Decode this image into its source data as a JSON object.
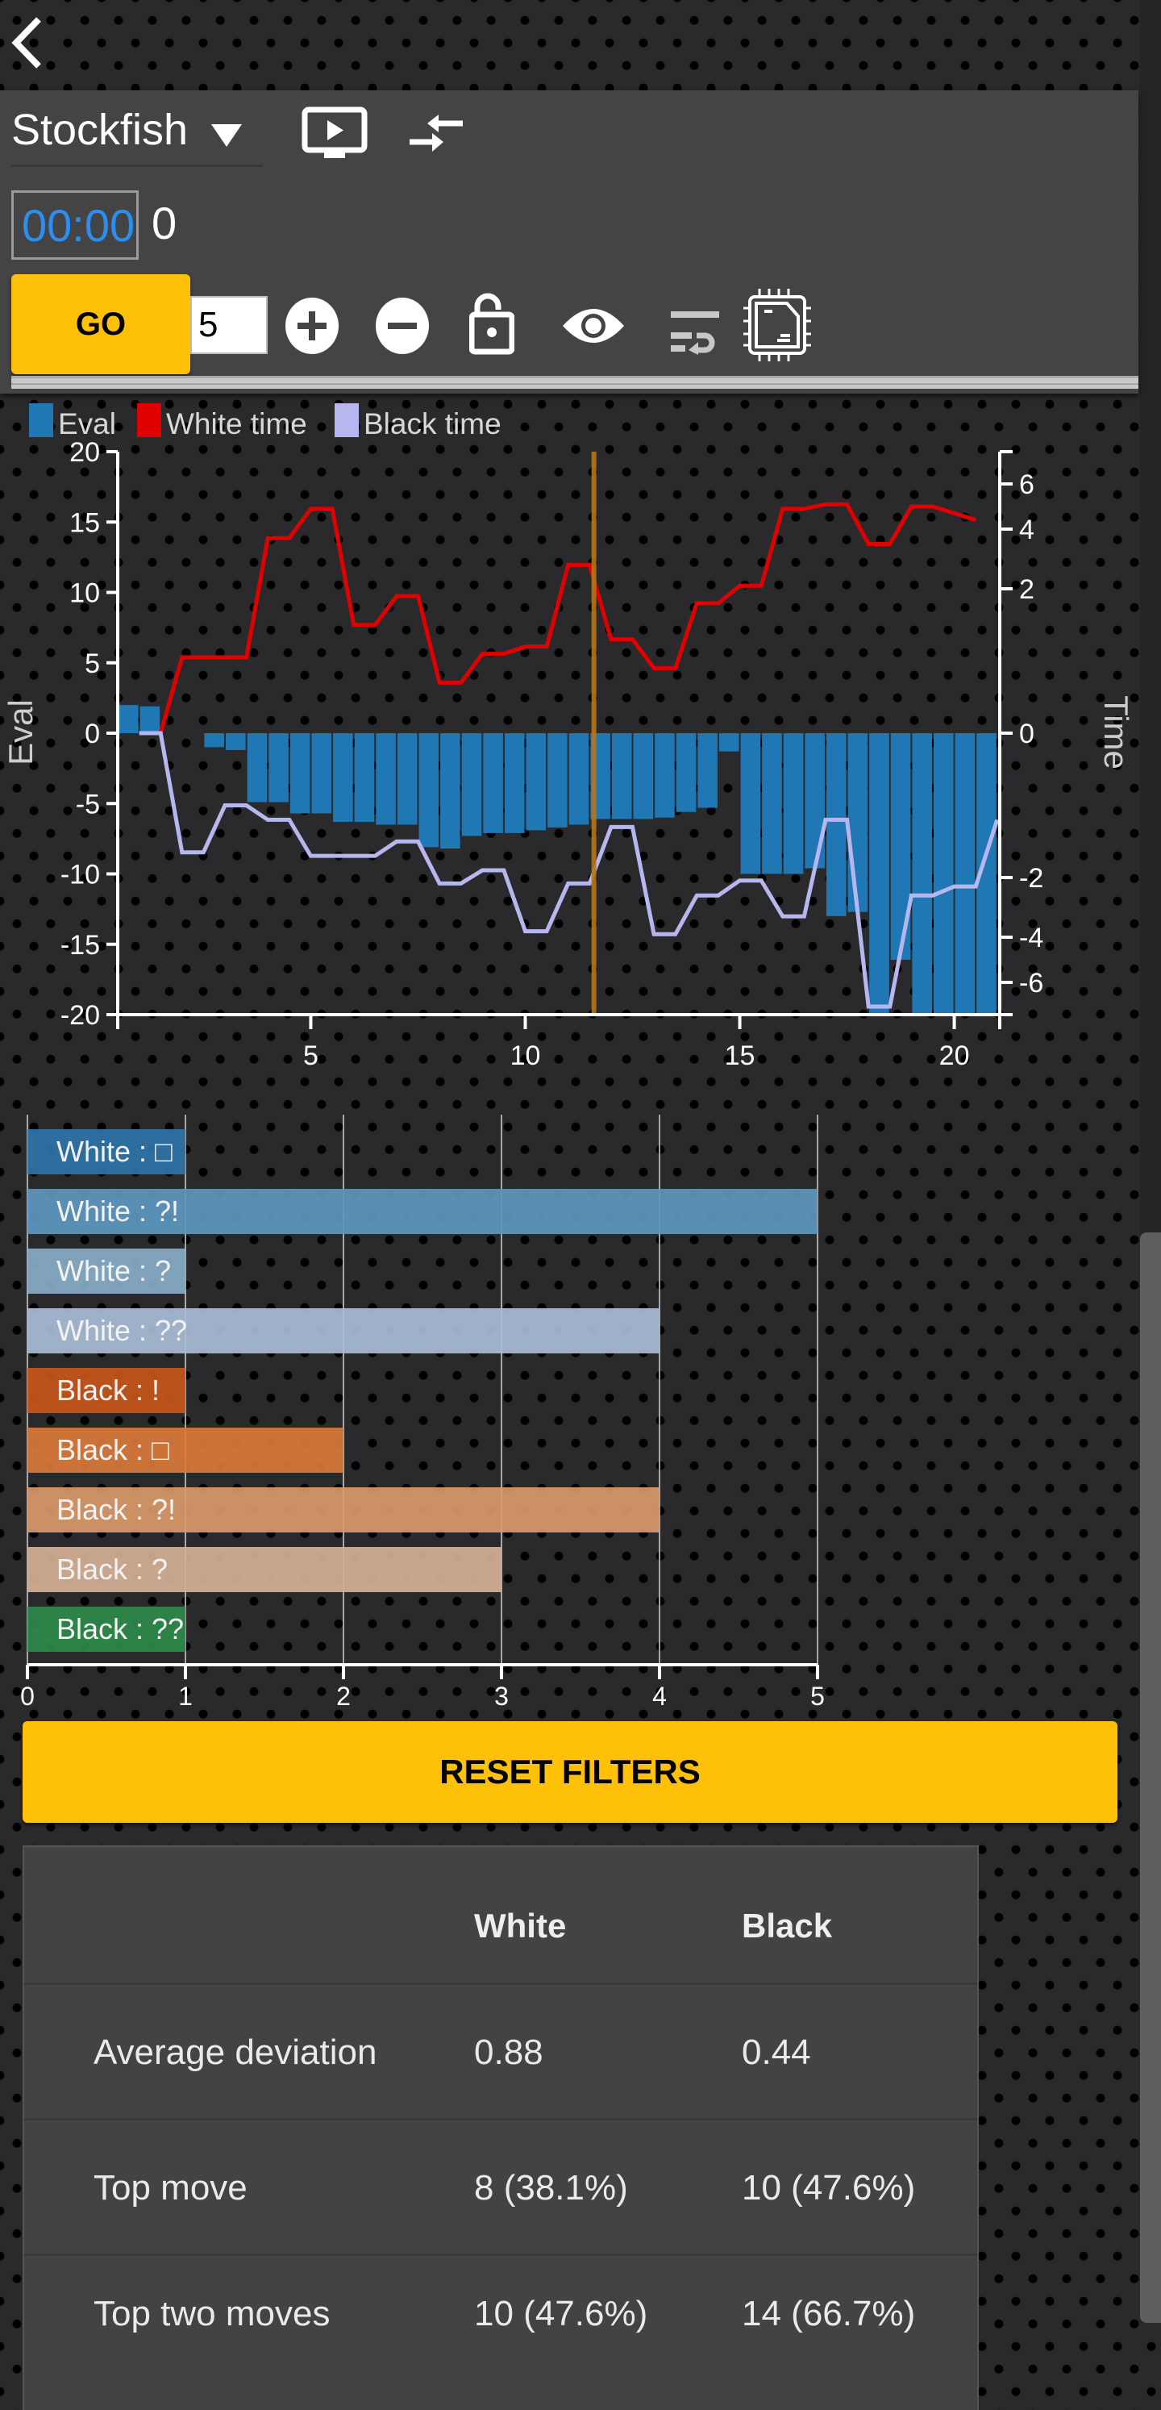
{
  "nav": {
    "back_icon": "chevron-left-icon"
  },
  "engine": {
    "name": "Stockfish",
    "timer": "00:00",
    "nodes": "0",
    "go_label": "GO",
    "depth_value": "5",
    "icons": [
      "monitor-play-icon",
      "collapse-arrows-icon",
      "plus-circle-icon",
      "minus-circle-icon",
      "unlock-icon",
      "eye-icon",
      "wrap-lines-icon",
      "cpu-chip-icon"
    ]
  },
  "chart_data": [
    {
      "type": "bar+line",
      "title": "",
      "legend": [
        {
          "name": "Eval",
          "color": "#1f77b4"
        },
        {
          "name": "White time",
          "color": "#e00000"
        },
        {
          "name": "Black time",
          "color": "#b7b7f0"
        }
      ],
      "legend_placement": "top-left",
      "xlabel": "",
      "ylabel": "Eval",
      "y2label": "Time",
      "x_ticks": [
        5,
        10,
        15,
        20
      ],
      "x_range": [
        0.5,
        21.06
      ],
      "ylim": [
        -20,
        20
      ],
      "y_ticks": [
        20,
        15,
        10,
        5,
        0,
        -5,
        -10,
        -15,
        -20
      ],
      "y2_ticks": [
        6,
        4,
        2,
        0,
        -2,
        -4,
        -6
      ],
      "current_move_marker": 11.6,
      "eval": {
        "x": [
          0.5,
          1,
          1.5,
          2,
          2.5,
          3,
          3.5,
          4,
          4.5,
          5,
          5.5,
          6,
          6.5,
          7,
          7.5,
          8,
          8.5,
          9,
          9.5,
          10,
          10.5,
          11,
          11.5,
          12,
          12.5,
          13,
          13.5,
          14,
          14.5,
          15,
          15.5,
          16,
          16.5,
          17,
          17.5,
          18,
          18.5,
          19,
          19.5,
          20,
          20.5
        ],
        "values": [
          2.0,
          1.9,
          0,
          0,
          -1.0,
          -1.2,
          -4.9,
          -4.9,
          -5.7,
          -5.7,
          -6.3,
          -6.3,
          -6.5,
          -6.5,
          -8.1,
          -8.2,
          -7.3,
          -7.1,
          -7.1,
          -6.9,
          -6.7,
          -6.5,
          -6.1,
          -6.1,
          -6.1,
          -6.0,
          -5.6,
          -5.3,
          -1.3,
          -10.0,
          -10.0,
          -10.0,
          -9.6,
          -13.0,
          -12.7,
          -20.0,
          -16.1,
          -20.0,
          -20.0,
          -20.0,
          -20.0
        ]
      },
      "white_time": {
        "x": [
          1,
          1.5,
          2,
          2.5,
          3,
          3.5,
          4,
          4.5,
          5,
          5.5,
          6,
          6.5,
          7,
          7.5,
          8,
          8.5,
          9,
          9.5,
          10,
          10.5,
          11,
          11.5,
          12,
          12.5,
          13,
          13.5,
          14,
          14.5,
          15,
          15.5,
          16,
          16.5,
          17,
          17.5,
          18,
          18.5,
          19,
          19.5,
          20,
          20.5
        ],
        "values": [
          0,
          0,
          1.05,
          1.05,
          1.05,
          1.05,
          3.7,
          3.7,
          4.9,
          4.9,
          1.5,
          1.5,
          1.9,
          1.9,
          0.7,
          0.7,
          1.1,
          1.1,
          1.2,
          1.2,
          2.8,
          2.8,
          1.3,
          1.3,
          0.9,
          0.9,
          1.8,
          1.8,
          2.1,
          2.1,
          4.9,
          4.9,
          5.1,
          5.1,
          3.5,
          3.5,
          5.0,
          5.0,
          4.7,
          4.4
        ]
      },
      "black_time": {
        "x": [
          1,
          1.5,
          2,
          2.5,
          3,
          3.5,
          4,
          4.5,
          5,
          5.5,
          6,
          6.5,
          7,
          7.5,
          8,
          8.5,
          9,
          9.5,
          10,
          10.5,
          11,
          11.5,
          12,
          12.5,
          13,
          13.5,
          14,
          14.5,
          15,
          15.5,
          16,
          16.5,
          17,
          17.5,
          18,
          18.5,
          19,
          19.5,
          20,
          20.5,
          21
        ],
        "values": [
          0,
          0,
          -1.65,
          -1.65,
          -1.0,
          -1.0,
          -1.2,
          -1.2,
          -1.7,
          -1.7,
          -1.7,
          -1.7,
          -1.5,
          -1.5,
          -2.2,
          -2.2,
          -1.9,
          -1.9,
          -3.8,
          -3.8,
          -2.2,
          -2.2,
          -1.3,
          -1.3,
          -3.9,
          -3.9,
          -2.6,
          -2.6,
          -2.1,
          -2.1,
          -3.3,
          -3.3,
          -1.2,
          -1.2,
          -6.9,
          -6.9,
          -2.6,
          -2.6,
          -2.3,
          -2.3,
          -1.2
        ]
      }
    },
    {
      "type": "bar",
      "orientation": "horizontal",
      "categories": [
        "White : □",
        "White : ?!",
        "White : ?",
        "White : ??",
        "Black : !",
        "Black : □",
        "Black : ?!",
        "Black : ?",
        "Black : ??"
      ],
      "values": [
        1,
        5,
        1,
        4,
        1,
        2,
        4,
        3,
        1
      ],
      "colors": [
        "#2f74a8",
        "#5d98c0",
        "#88aec8",
        "#a9bdd6",
        "#c8561a",
        "#d97939",
        "#d99a6a",
        "#d6b196",
        "#2e8b4a"
      ],
      "x_ticks": [
        0,
        1,
        2,
        3,
        4,
        5
      ],
      "xlim": [
        0,
        5
      ],
      "grid": true
    }
  ],
  "actions": {
    "reset_label": "RESET FILTERS"
  },
  "stats": {
    "headers": [
      "",
      "White",
      "Black"
    ],
    "rows": [
      {
        "label": "Average deviation",
        "white": "0.88",
        "black": "0.44"
      },
      {
        "label": "Top move",
        "white": "8 (38.1%)",
        "black": "10 (47.6%)"
      },
      {
        "label": "Top two moves",
        "white": "10 (47.6%)",
        "black": "14 (66.7%)"
      }
    ]
  }
}
